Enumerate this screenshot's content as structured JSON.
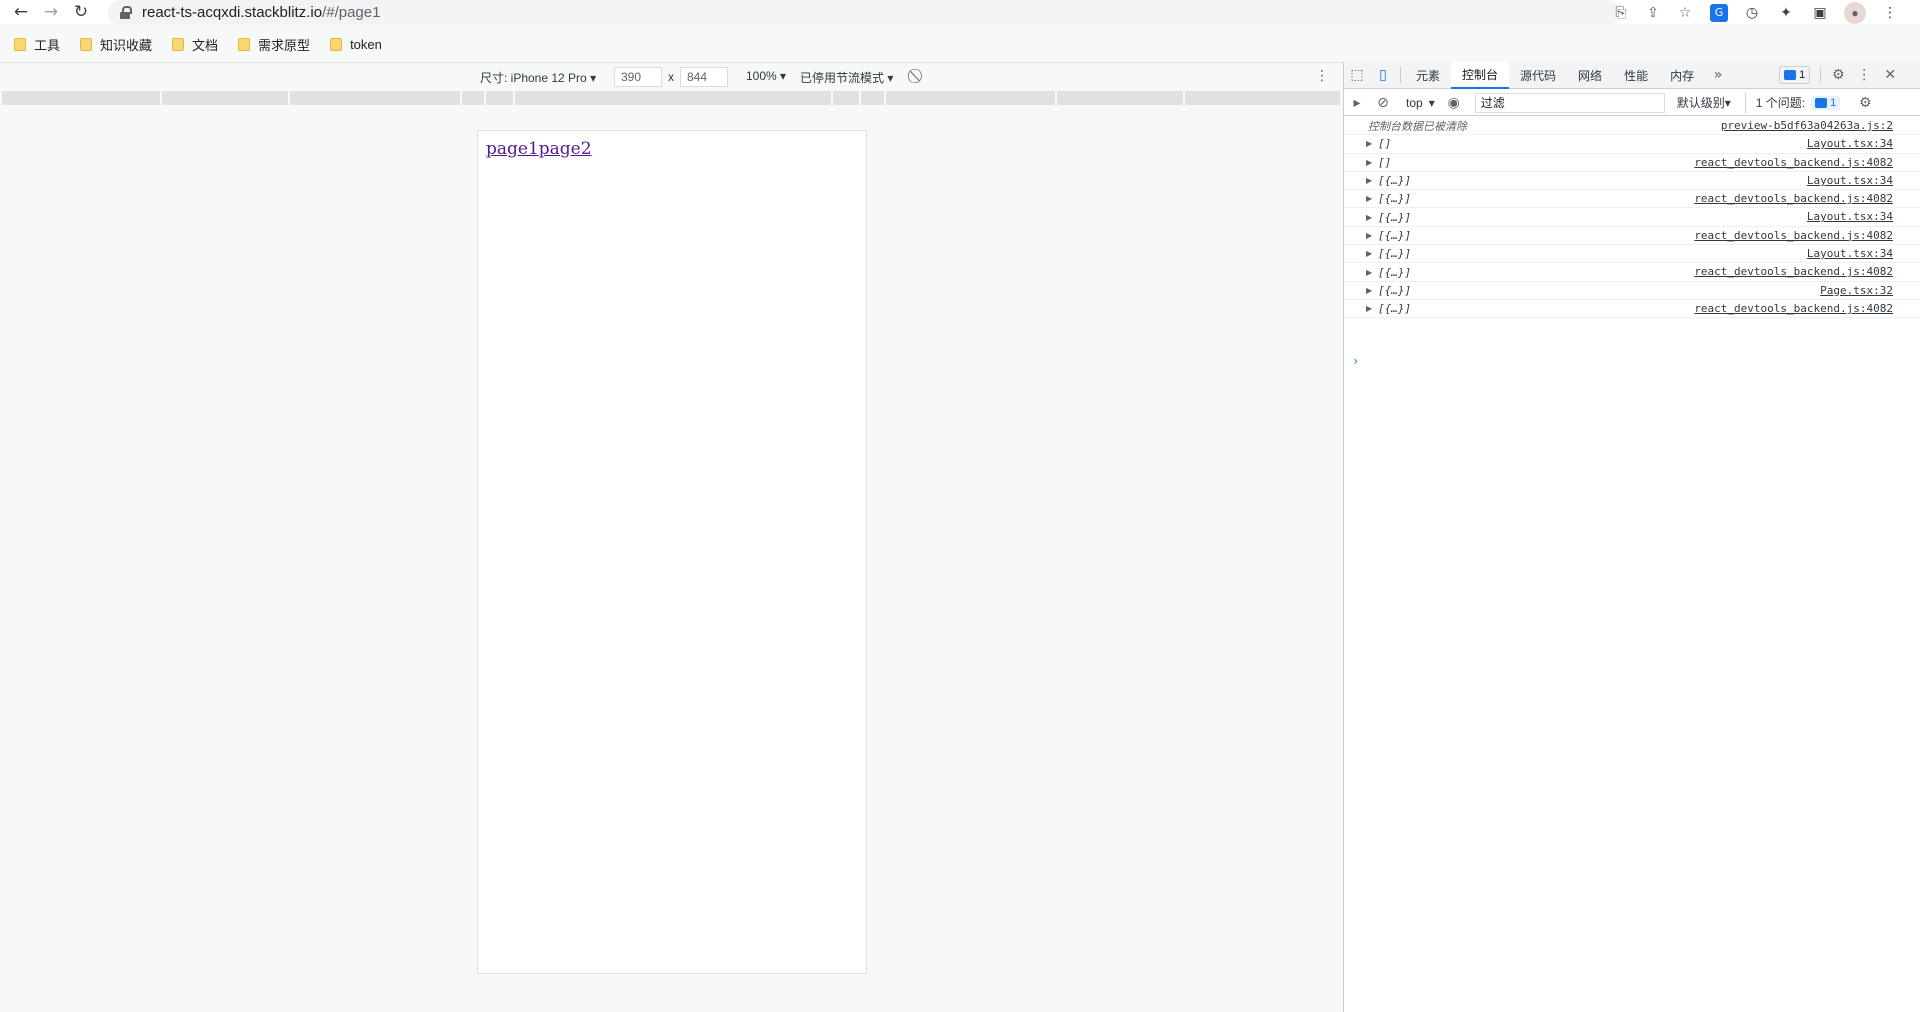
{
  "browser": {
    "url_host": "react-ts-acqxdi.stackblitz.io",
    "url_path": "/#/page1",
    "bookmarks": [
      "工具",
      "知识收藏",
      "文档",
      "需求原型",
      "token"
    ]
  },
  "device_toolbar": {
    "device_label": "尺寸: iPhone 12 Pro",
    "width": "390",
    "height": "844",
    "times": "x",
    "zoom": "100%",
    "throttle": "已停用节流模式"
  },
  "page": {
    "links": [
      "page1",
      "page2"
    ]
  },
  "devtools": {
    "tabs": [
      "元素",
      "控制台",
      "源代码",
      "网络",
      "性能",
      "内存"
    ],
    "active_tab": "控制台",
    "issues_badge": "1",
    "console_context": "top",
    "filter_placeholder": "过滤",
    "log_level": "默认级别",
    "issues_label": "1 个问题:",
    "issues_count": "1",
    "cleared_message": "控制台数据已被清除",
    "cleared_source": "preview-b5df63a04263a.js:2",
    "logs": [
      {
        "value": "[]",
        "source": "Layout.tsx:34"
      },
      {
        "value": "[]",
        "source": "react_devtools_backend.js:4082"
      },
      {
        "value": "[{…}]",
        "source": "Layout.tsx:34"
      },
      {
        "value": "[{…}]",
        "source": "react_devtools_backend.js:4082"
      },
      {
        "value": "[{…}]",
        "source": "Layout.tsx:34"
      },
      {
        "value": "[{…}]",
        "source": "react_devtools_backend.js:4082"
      },
      {
        "value": "[{…}]",
        "source": "Layout.tsx:34"
      },
      {
        "value": "[{…}]",
        "source": "react_devtools_backend.js:4082"
      },
      {
        "value": "[{…}]",
        "source": "Page.tsx:32"
      },
      {
        "value": "[{…}]",
        "source": "react_devtools_backend.js:4082"
      }
    ],
    "prompt": "›"
  },
  "colors": {
    "accent": "#1a73e8",
    "visited_link": "#551a8b",
    "folder": "#f8d775"
  }
}
